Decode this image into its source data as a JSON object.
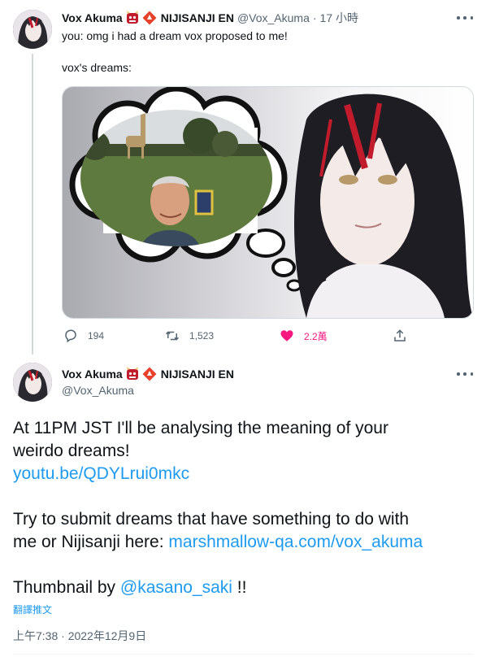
{
  "tweet1": {
    "display_name": "Vox Akuma",
    "org_label": "NIJISANJI EN",
    "handle": "@Vox_Akuma",
    "separator": "·",
    "time": "17 小時",
    "text_line1": "you: omg i had a dream vox proposed to me!",
    "text_line2": "vox's dreams:",
    "reply_count": "194",
    "retweet_count": "1,523",
    "like_count": "2.2萬",
    "like_color": "#f91880"
  },
  "tweet2": {
    "display_name": "Vox Akuma",
    "org_label": "NIJISANJI EN",
    "handle": "@Vox_Akuma",
    "body_line1": "At 11PM JST I'll be analysing the meaning of your",
    "body_line2": "weirdo dreams!",
    "link1": "youtu.be/QDYLrui0mkc",
    "body_line3": "Try to submit dreams that have something to do with",
    "body_line4_prefix": "me or Nijisanji here: ",
    "link2": "marshmallow-qa.com/vox_akuma",
    "body_line5_prefix": "Thumbnail by ",
    "mention": "@kasano_saki",
    "body_line5_suffix": " !!",
    "translate": "翻譯推文",
    "timestamp": "上午7:38 · 2022年12月9日"
  },
  "colors": {
    "accent": "#1d9bf0",
    "text": "#0f1419",
    "muted": "#536471"
  },
  "icons": {
    "more": "more-horizontal-icon",
    "reply": "reply-icon",
    "retweet": "retweet-icon",
    "like": "heart-filled-icon",
    "share": "share-icon",
    "emoji_badge": "oni-mask-emoji",
    "affiliate_badge": "nijisanji-affiliate-badge"
  }
}
